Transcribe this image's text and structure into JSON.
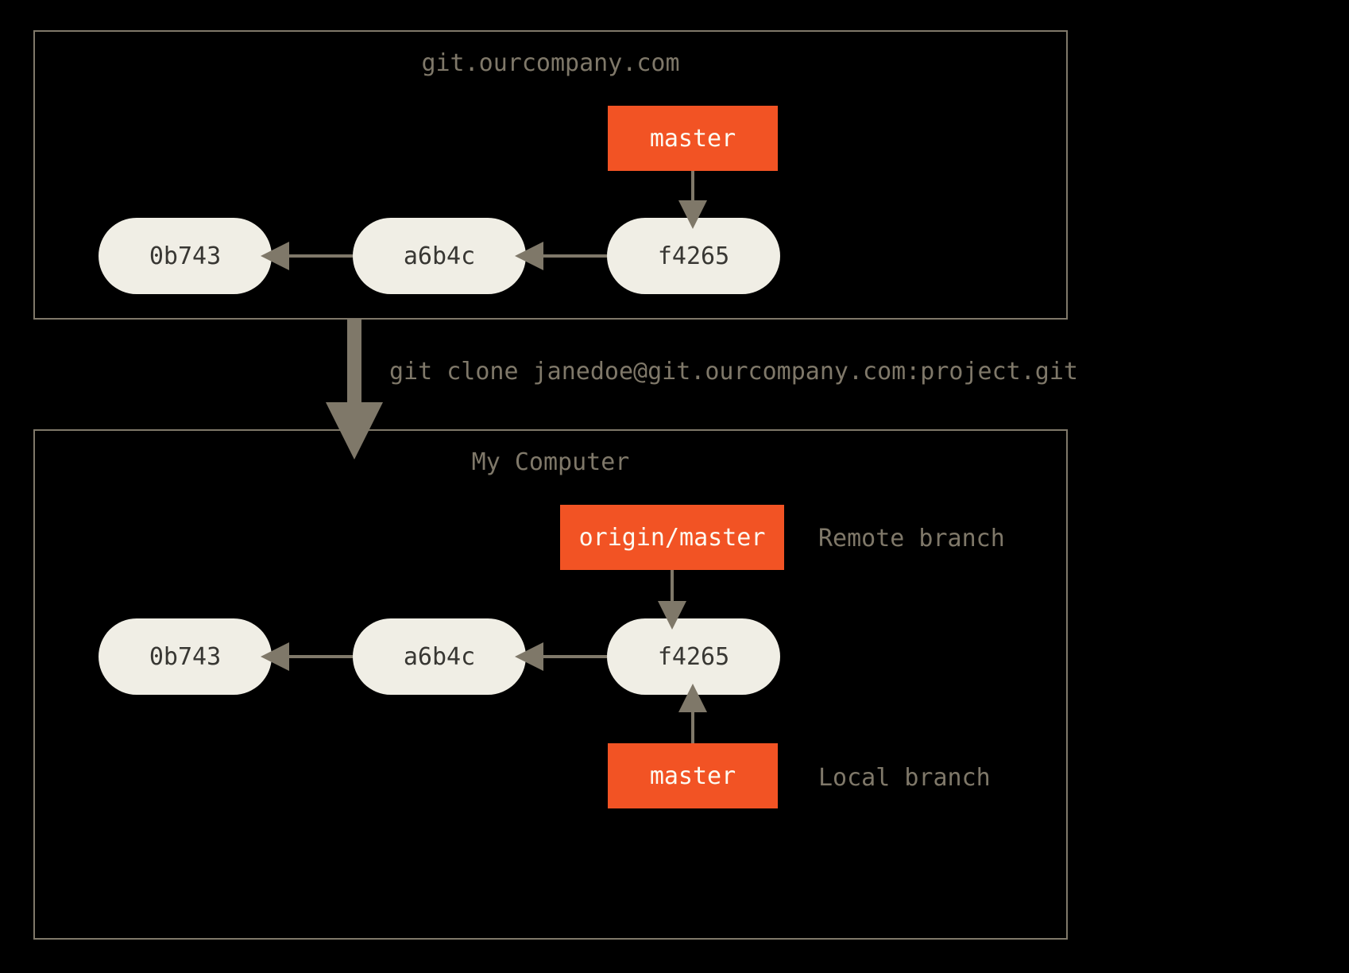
{
  "server": {
    "title": "git.ourcompany.com",
    "commits": [
      "0b743",
      "a6b4c",
      "f4265"
    ],
    "branch": "master"
  },
  "clone_command": "git clone janedoe@git.ourcompany.com:project.git",
  "local": {
    "title": "My Computer",
    "commits": [
      "0b743",
      "a6b4c",
      "f4265"
    ],
    "remote_branch": "origin/master",
    "remote_branch_note": "Remote branch",
    "local_branch": "master",
    "local_branch_note": "Local branch"
  },
  "colors": {
    "background": "#000000",
    "panel_border": "#7f7869",
    "text_muted": "#7f7869",
    "commit_fill": "#f0eee5",
    "commit_text": "#383733",
    "branch_fill": "#f25324",
    "branch_text": "#fdfbf2",
    "arrow": "#7f7869"
  }
}
